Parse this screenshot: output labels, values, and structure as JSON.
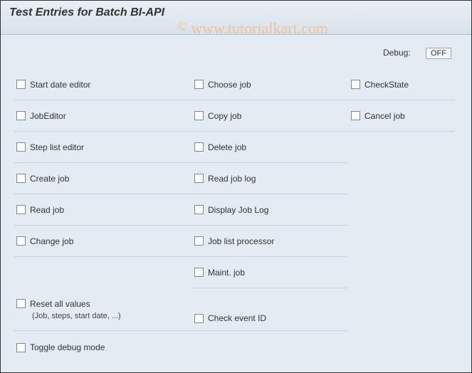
{
  "title": "Test Entries for Batch BI-API",
  "watermark": "www.tutorialkart.com",
  "debug": {
    "label": "Debug:",
    "value": "OFF"
  },
  "columns": {
    "col1": [
      "Start date editor",
      "JobEditor",
      "Step list editor",
      "Create job",
      "Read job",
      "Change job"
    ],
    "col2": [
      "Choose job",
      "Copy job",
      "Delete job",
      "Read job log",
      "Display Job Log",
      "Job list processor",
      "Maint. job",
      "Check event ID"
    ],
    "col3": [
      "CheckState",
      "Cancel job"
    ]
  },
  "reset": {
    "label": "Reset all values",
    "sub": "(Job, steps, start date, ...)"
  },
  "toggle": "Toggle debug mode"
}
